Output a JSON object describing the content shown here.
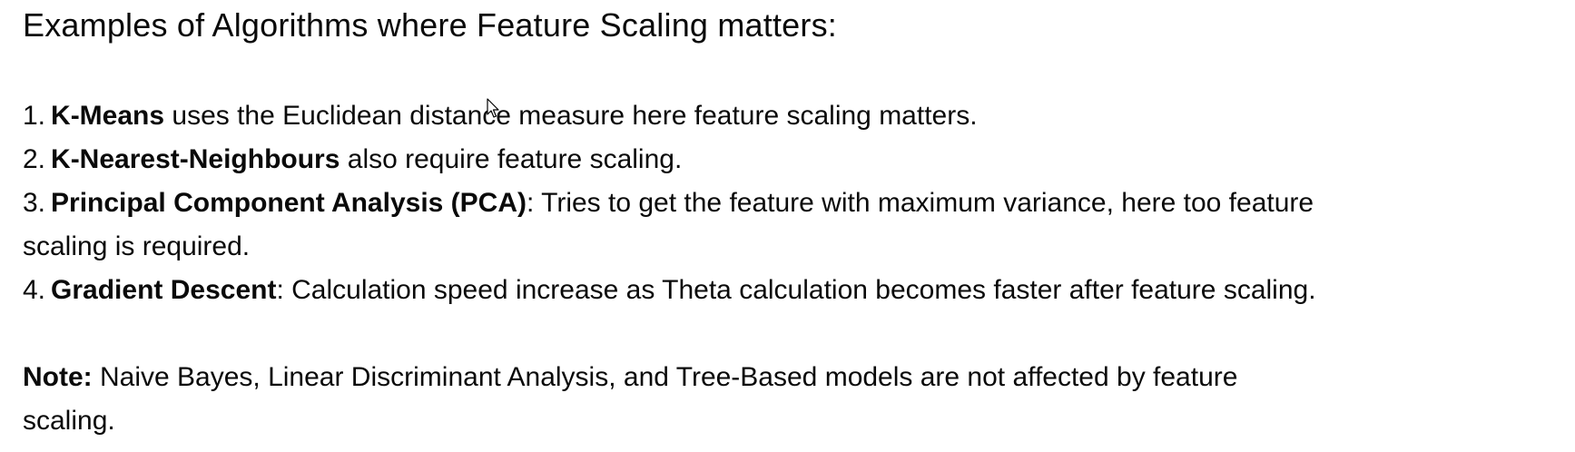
{
  "slide": {
    "title": "Examples of Algorithms where Feature Scaling matters:",
    "items": [
      {
        "number": "1.",
        "term": "K-Means",
        "rest": " uses the Euclidean distance measure here feature scaling matters."
      },
      {
        "number": "2.",
        "term": "K-Nearest-Neighbours",
        "rest": " also require feature scaling."
      },
      {
        "number": "3.",
        "term": "Principal Component Analysis (PCA)",
        "rest": ": Tries to get the feature with maximum variance, here too feature",
        "rest_line2": "scaling is required."
      },
      {
        "number": "4.",
        "term": "Gradient Descent",
        "rest": ": Calculation speed increase as Theta calculation becomes faster after feature scaling."
      }
    ],
    "note": {
      "label": "Note:",
      "text_line1": " Naive Bayes, Linear Discriminant Analysis, and Tree-Based models are not affected by feature",
      "text_line2": "scaling."
    }
  },
  "icons": {
    "cursor": "mouse-pointer-icon"
  }
}
